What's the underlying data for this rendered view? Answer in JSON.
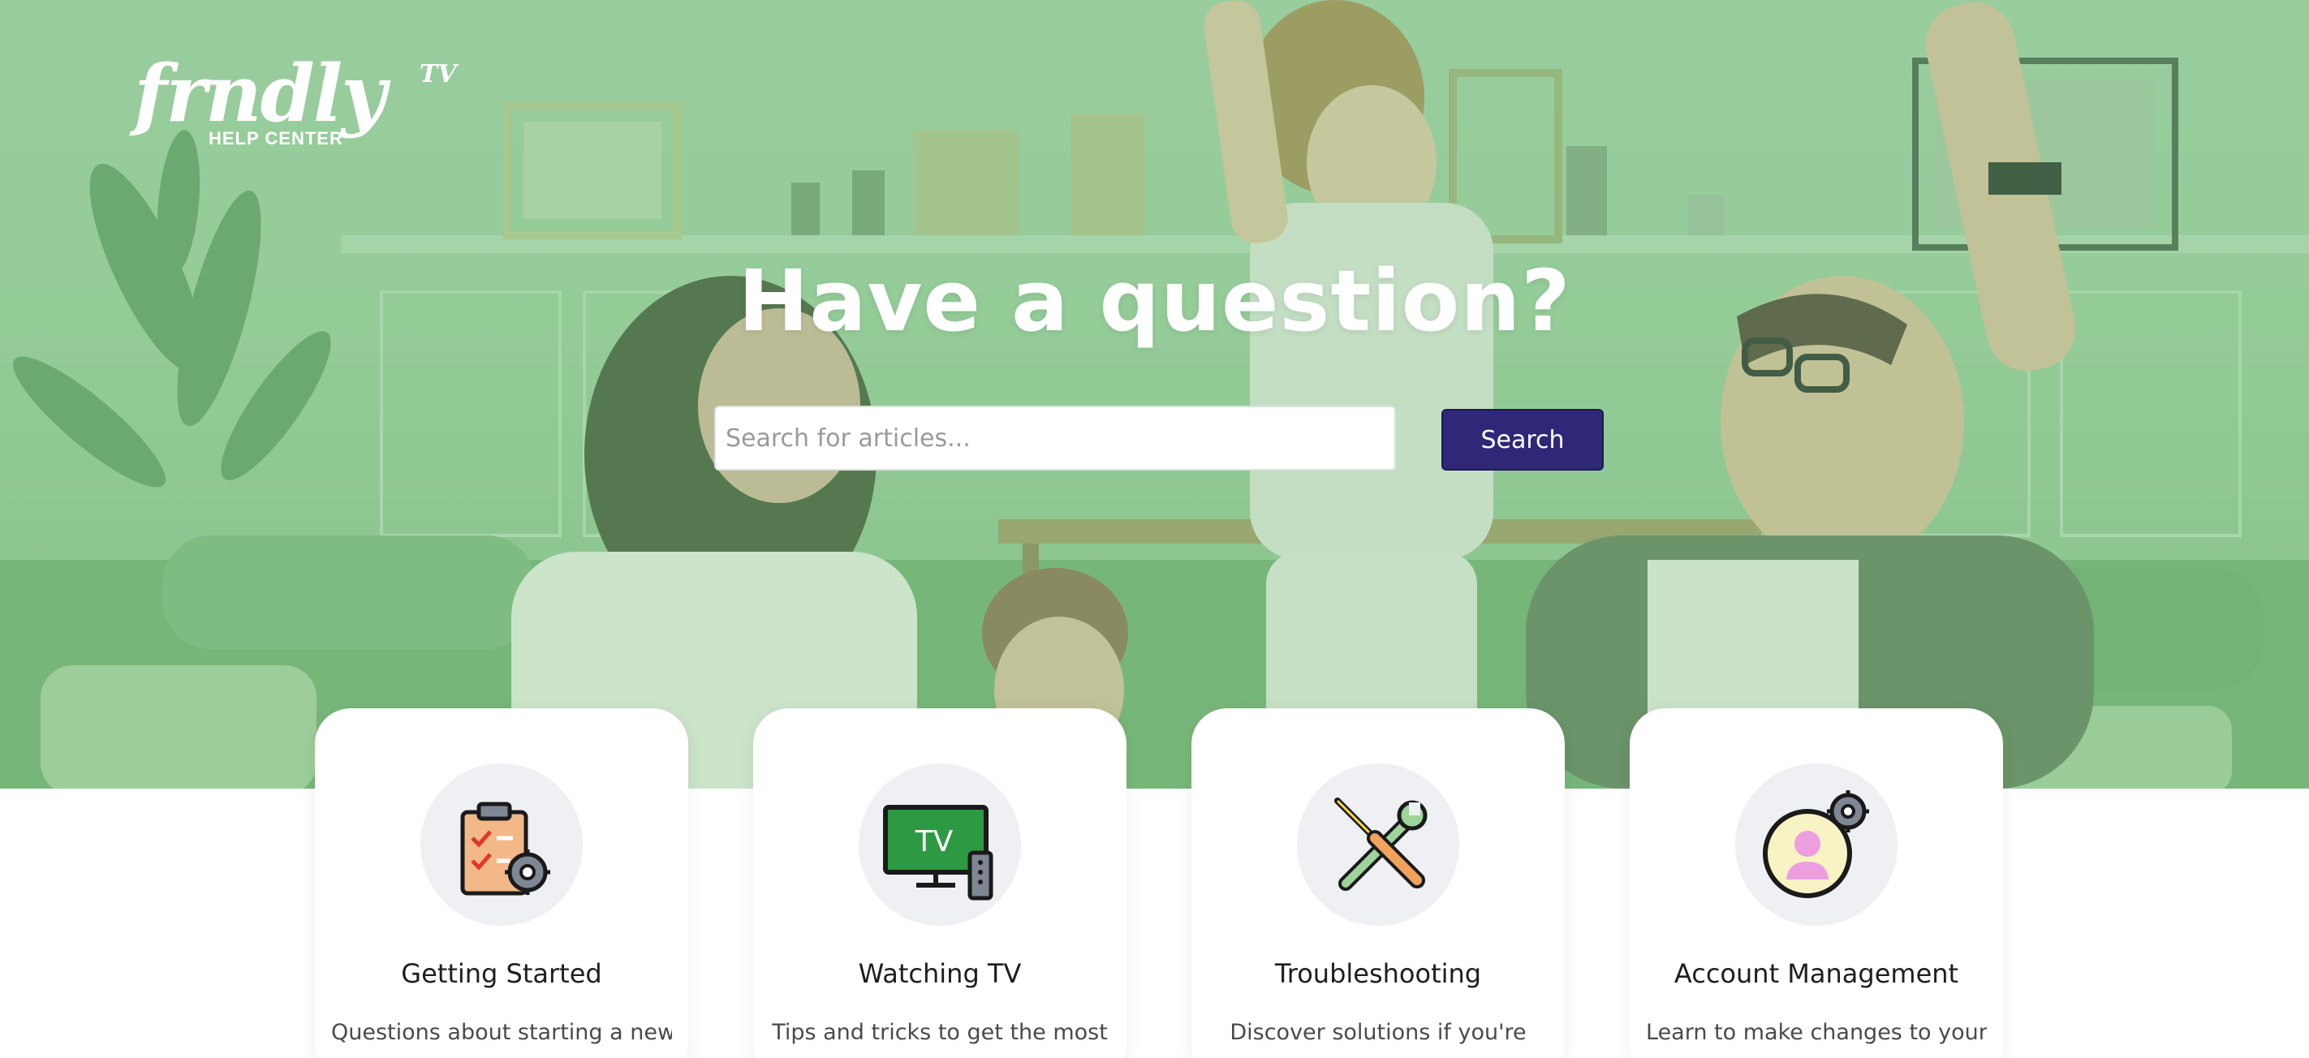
{
  "brand": {
    "logo_word": "frndly",
    "logo_tv": "TV",
    "logo_sub": "HELP CENTER"
  },
  "hero": {
    "headline": "Have a question?",
    "search_placeholder": "Search for articles...",
    "search_button": "Search"
  },
  "cards": [
    {
      "title": "Getting Started",
      "description": "Questions about starting a new",
      "icon": "clipboard-gear-icon"
    },
    {
      "title": "Watching TV",
      "description": "Tips and tricks to get the most",
      "icon": "tv-remote-icon"
    },
    {
      "title": "Troubleshooting",
      "description": "Discover solutions if you're",
      "icon": "wrench-screwdriver-icon"
    },
    {
      "title": "Account Management",
      "description": "Learn to make changes to your",
      "icon": "user-gear-icon"
    }
  ],
  "colors": {
    "hero_green": "#9ccf9f",
    "search_button": "#2f2878",
    "card_icon_bg": "#eef0f4"
  }
}
